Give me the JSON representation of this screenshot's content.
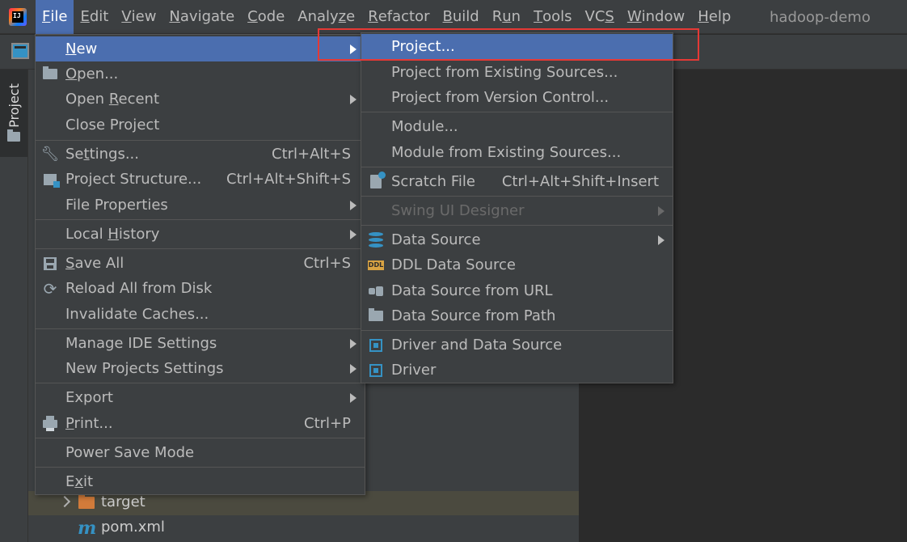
{
  "menubar": {
    "items": [
      {
        "pre": "",
        "u": "F",
        "post": "ile"
      },
      {
        "pre": "",
        "u": "E",
        "post": "dit"
      },
      {
        "pre": "",
        "u": "V",
        "post": "iew"
      },
      {
        "pre": "",
        "u": "N",
        "post": "avigate"
      },
      {
        "pre": "",
        "u": "C",
        "post": "ode"
      },
      {
        "pre": "Analy",
        "u": "z",
        "post": "e"
      },
      {
        "pre": "",
        "u": "R",
        "post": "efactor"
      },
      {
        "pre": "",
        "u": "B",
        "post": "uild"
      },
      {
        "pre": "R",
        "u": "u",
        "post": "n"
      },
      {
        "pre": "",
        "u": "T",
        "post": "ools"
      },
      {
        "pre": "VC",
        "u": "S",
        "post": ""
      },
      {
        "pre": "",
        "u": "W",
        "post": "indow"
      },
      {
        "pre": "",
        "u": "H",
        "post": "elp"
      }
    ],
    "project_name": "hadoop-demo"
  },
  "tool_window": {
    "project_tab": "Project"
  },
  "tree": {
    "target": "target",
    "pom": "pom.xml"
  },
  "file_menu": {
    "new": {
      "pre": "",
      "u": "N",
      "post": "ew"
    },
    "open": {
      "pre": "",
      "u": "O",
      "post": "pen..."
    },
    "open_recent": {
      "pre": "Open ",
      "u": "R",
      "post": "ecent"
    },
    "close_project": "Close Project",
    "settings": {
      "pre": "Se",
      "u": "t",
      "post": "tings..."
    },
    "settings_shortcut": "Ctrl+Alt+S",
    "project_structure": "Project Structure...",
    "project_structure_shortcut": "Ctrl+Alt+Shift+S",
    "file_properties": "File Properties",
    "local_history": {
      "pre": "Local ",
      "u": "H",
      "post": "istory"
    },
    "save_all": {
      "pre": "",
      "u": "S",
      "post": "ave All"
    },
    "save_all_shortcut": "Ctrl+S",
    "reload_all": "Reload All from Disk",
    "invalidate_caches": "Invalidate Caches...",
    "manage_ide_settings": "Manage IDE Settings",
    "new_projects_settings": "New Projects Settings",
    "export": "Export",
    "print": {
      "pre": "",
      "u": "P",
      "post": "rint..."
    },
    "print_shortcut": "Ctrl+P",
    "power_save_mode": "Power Save Mode",
    "exit": {
      "pre": "E",
      "u": "x",
      "post": "it"
    }
  },
  "new_submenu": {
    "project": "Project...",
    "project_existing": "Project from Existing Sources...",
    "project_vcs": "Project from Version Control...",
    "module": "Module...",
    "module_existing": "Module from Existing Sources...",
    "scratch_file": "Scratch File",
    "scratch_file_shortcut": "Ctrl+Alt+Shift+Insert",
    "swing_ui_designer": "Swing UI Designer",
    "data_source": "Data Source",
    "ddl_data_source": "DDL Data Source",
    "data_source_url": "Data Source from URL",
    "data_source_path": "Data Source from Path",
    "driver_and_data_source": "Driver and Data Source",
    "driver": "Driver"
  },
  "icons": {
    "ddl_badge": "DDL"
  },
  "colors": {
    "selection": "#4b6eaf",
    "highlight": "#e53935",
    "accent_blue": "#3592c4"
  }
}
